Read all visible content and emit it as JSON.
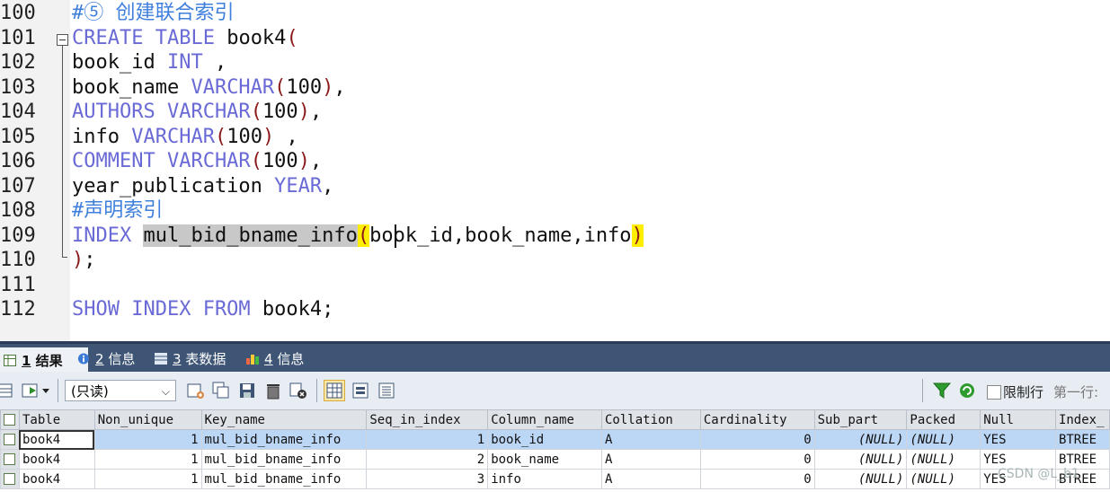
{
  "editor": {
    "lines": [
      {
        "num": "100",
        "tokens": [
          {
            "t": "#⑤ 创建联合索引",
            "c": "cm"
          }
        ]
      },
      {
        "num": "101",
        "tokens": [
          {
            "t": "CREATE TABLE",
            "c": "kw"
          },
          {
            "t": " book4",
            "c": ""
          },
          {
            "t": "(",
            "c": "pn"
          }
        ]
      },
      {
        "num": "102",
        "tokens": [
          {
            "t": "book_id ",
            "c": ""
          },
          {
            "t": "INT",
            "c": "kw"
          },
          {
            "t": " ,",
            "c": ""
          }
        ]
      },
      {
        "num": "103",
        "tokens": [
          {
            "t": "book_name ",
            "c": ""
          },
          {
            "t": "VARCHAR",
            "c": "kw"
          },
          {
            "t": "(",
            "c": "pn"
          },
          {
            "t": "100",
            "c": ""
          },
          {
            "t": ")",
            "c": "pn"
          },
          {
            "t": ",",
            "c": ""
          }
        ]
      },
      {
        "num": "104",
        "tokens": [
          {
            "t": "AUTHORS VARCHAR",
            "c": "kw"
          },
          {
            "t": "(",
            "c": "pn"
          },
          {
            "t": "100",
            "c": ""
          },
          {
            "t": ")",
            "c": "pn"
          },
          {
            "t": ",",
            "c": ""
          }
        ]
      },
      {
        "num": "105",
        "tokens": [
          {
            "t": "info ",
            "c": ""
          },
          {
            "t": "VARCHAR",
            "c": "kw"
          },
          {
            "t": "(",
            "c": "pn"
          },
          {
            "t": "100",
            "c": ""
          },
          {
            "t": ")",
            "c": "pn"
          },
          {
            "t": " ,",
            "c": ""
          }
        ]
      },
      {
        "num": "106",
        "tokens": [
          {
            "t": "COMMENT VARCHAR",
            "c": "kw"
          },
          {
            "t": "(",
            "c": "pn"
          },
          {
            "t": "100",
            "c": ""
          },
          {
            "t": ")",
            "c": "pn"
          },
          {
            "t": ",",
            "c": ""
          }
        ]
      },
      {
        "num": "107",
        "tokens": [
          {
            "t": "year_publication ",
            "c": ""
          },
          {
            "t": "YEAR",
            "c": "kw"
          },
          {
            "t": ",",
            "c": ""
          }
        ]
      },
      {
        "num": "108",
        "tokens": [
          {
            "t": "#声明索引",
            "c": "cm"
          }
        ]
      },
      {
        "num": "109",
        "tokens": [
          {
            "t": "INDEX",
            "c": "kw"
          },
          {
            "t": " ",
            "c": ""
          },
          {
            "t": "mul_bid_bname_info",
            "c": "sel"
          },
          {
            "t": "(",
            "c": "brk"
          },
          {
            "t": "book_id,book_name,info",
            "c": ""
          },
          {
            "t": ")",
            "c": "brk"
          }
        ]
      },
      {
        "num": "110",
        "tokens": [
          {
            "t": ")",
            "c": "pn"
          },
          {
            "t": ";",
            "c": ""
          }
        ]
      },
      {
        "num": "111",
        "tokens": []
      },
      {
        "num": "112",
        "tokens": [
          {
            "t": "SHOW INDEX FROM",
            "c": "kw"
          },
          {
            "t": " book4;",
            "c": ""
          }
        ]
      }
    ]
  },
  "tabs": [
    {
      "num": "1",
      "label": " 结果",
      "icon": "result-grid-icon"
    },
    {
      "num": "2",
      "label": " 信息",
      "icon": "info-icon"
    },
    {
      "num": "3",
      "label": " 表数据",
      "icon": "table-data-icon"
    },
    {
      "num": "4",
      "label": " 信息",
      "icon": "info-chart-icon"
    }
  ],
  "toolbar": {
    "mode_value": "(只读)",
    "limit_label": "限制行",
    "first_row_label": "第一行:"
  },
  "grid": {
    "columns": [
      "Table",
      "Non_unique",
      "Key_name",
      "Seq_in_index",
      "Column_name",
      "Collation",
      "Cardinality",
      "Sub_part",
      "Packed",
      "Null",
      "Index_"
    ],
    "rows": [
      [
        "book4",
        "1",
        "mul_bid_bname_info",
        "1",
        "book_id",
        "A",
        "0",
        "(NULL)",
        "(NULL)",
        "YES",
        "BTREE"
      ],
      [
        "book4",
        "1",
        "mul_bid_bname_info",
        "2",
        "book_name",
        "A",
        "0",
        "(NULL)",
        "(NULL)",
        "YES",
        "BTREE"
      ],
      [
        "book4",
        "1",
        "mul_bid_bname_info",
        "3",
        "info",
        "A",
        "0",
        "(NULL)",
        "(NULL)",
        "YES",
        "BTREE"
      ]
    ]
  },
  "watermark": "CSDN @L_b1",
  "colors": {
    "keyword": "#6a6ad6",
    "comment": "#3f7fdc",
    "paren": "#8b1a1a",
    "bracket_match": "#ffee00",
    "tab_bar": "#3e5575"
  }
}
